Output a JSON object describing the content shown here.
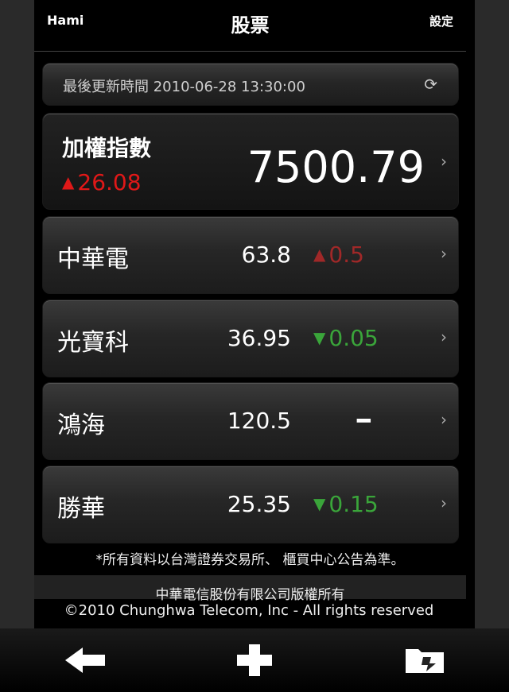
{
  "header": {
    "left": "Hami",
    "title": "股票",
    "right": "設定"
  },
  "update": {
    "text": "最後更新時間 2010-06-28 13:30:00"
  },
  "index": {
    "name": "加權指數",
    "change": "26.08",
    "direction": "up",
    "value": "7500.79"
  },
  "stocks": [
    {
      "name": "中華電",
      "price": "63.8",
      "change": "0.5",
      "direction": "up"
    },
    {
      "name": "光寶科",
      "price": "36.95",
      "change": "0.05",
      "direction": "down"
    },
    {
      "name": "鴻海",
      "price": "120.5",
      "change": "",
      "direction": "flat"
    },
    {
      "name": "勝華",
      "price": "25.35",
      "change": "0.15",
      "direction": "down"
    }
  ],
  "disclaimer": "*所有資料以台灣證券交易所、 櫃買中心公告為準。",
  "footer": {
    "zh": "中華電信股份有限公司版權所有",
    "en": "©2010 Chunghwa Telecom, Inc - All rights reserved"
  },
  "colors": {
    "up": "#e01818",
    "down": "#3aa53a"
  },
  "icons": [
    "refresh-icon",
    "chevron-right-icon",
    "back-arrow-icon",
    "add-icon",
    "folder-icon"
  ]
}
